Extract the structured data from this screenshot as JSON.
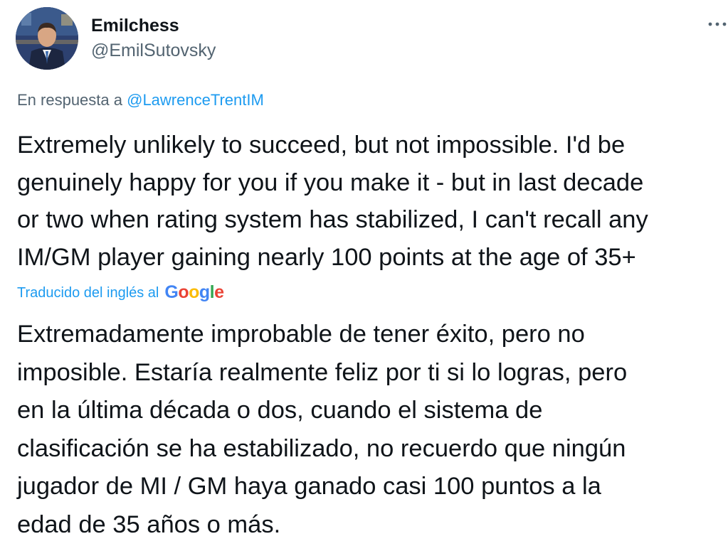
{
  "author": {
    "display_name": "Emilchess",
    "handle": "@EmilSutovsky",
    "avatar_icon": "profile-photo"
  },
  "reply": {
    "prefix": "En respuesta a",
    "mention": "@LawrenceTrentIM"
  },
  "original_text_lines": [
    "Extremely unlikely to succeed, but not impossible. I'd be",
    "genuinely happy for you if you make it - but in last decade",
    "or two when rating system has stabilized, I can't recall any",
    "IM/GM player gaining nearly 100 points at the age of 35+"
  ],
  "translation": {
    "note": "Traducido del inglés al",
    "provider_letters": [
      "G",
      "o",
      "o",
      "g",
      "l",
      "e"
    ],
    "provider_colors": [
      "#4285f4",
      "#ea4335",
      "#fbbc05",
      "#4285f4",
      "#34a853",
      "#ea4335"
    ]
  },
  "translated_text_lines": [
    "Extremadamente improbable de tener éxito, pero no",
    "imposible. Estaría realmente feliz por ti si lo logras, pero",
    "en la última década o dos, cuando el sistema de",
    "clasificación se ha estabilizado, no recuerdo que ningún",
    "jugador de MI / GM haya ganado casi 100 puntos a la",
    "edad de 35 años o más."
  ],
  "menu": {
    "icon": "more-horizontal-icon"
  }
}
